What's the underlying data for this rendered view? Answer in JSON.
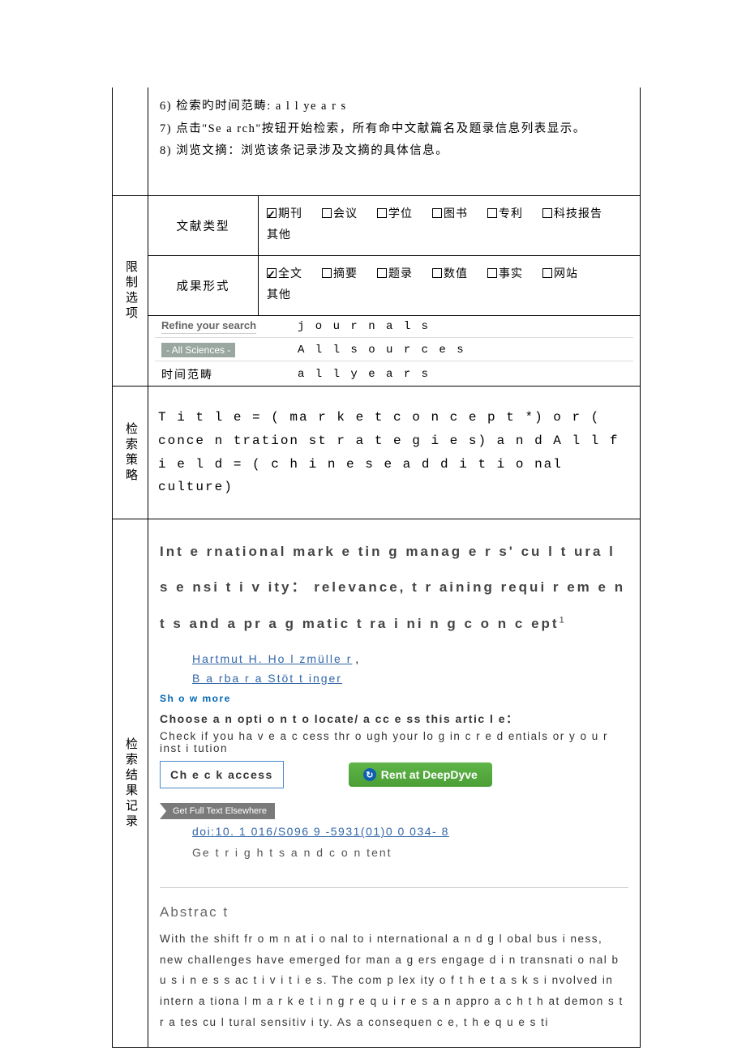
{
  "steps": {
    "s6": "6)  检索旳时间范畴: a l l ye a r s",
    "s7": "7)  点击\"Se a rch\"按钮开始检索，所有命中文献篇名及题录信息列表显示。",
    "s8": "8)  浏览文摘：浏览该条记录涉及文摘的具体信息。"
  },
  "limits": {
    "section_label": "限制选项",
    "doctype_label": "文献类型",
    "form_label": "成果形式",
    "doctypes": [
      {
        "label": "期刊",
        "checked": true
      },
      {
        "label": "会议",
        "checked": false
      },
      {
        "label": "学位",
        "checked": false
      },
      {
        "label": "图书",
        "checked": false
      },
      {
        "label": "专利",
        "checked": false
      },
      {
        "label": "科技报告",
        "checked": false
      }
    ],
    "doctype_other": "其他",
    "forms": [
      {
        "label": "全文",
        "checked": true
      },
      {
        "label": "摘要",
        "checked": false
      },
      {
        "label": "题录",
        "checked": false
      },
      {
        "label": "数值",
        "checked": false
      },
      {
        "label": "事实",
        "checked": false
      },
      {
        "label": "网站",
        "checked": false
      }
    ],
    "form_other": "其他",
    "refine_label": "Refine your search",
    "refine_val": "j o u r n a l s",
    "allsci_label": "- All Sciences -",
    "allsci_val": "A l l  s o u r c e s",
    "time_label": "时间范畴",
    "time_val": "a l l  y e a r s"
  },
  "strategy": {
    "section_label": "检索策略",
    "text": "T i t l e = ( ma r k e t  c o n c e p t *)  o r (  conce n tration st r a t e g i e s) a n d  A l l  f i e l d =  ( c h i n e s e   a d d i t i o nal culture)"
  },
  "result": {
    "section_label": "检索结果记录",
    "title": "Int e rnational mark e tin g   manag e r s' cu l t ura l  s e nsi t i v ity：   relevance,  t r aining requi r em e n t s and  a pr a g matic t ra i ni n g c o n c ept",
    "title_sup": "1",
    "author1": "Hartmut H. Ho l zmülle r",
    "author2": "B a rba r a Stöt t inger",
    "show_more": "Sh o w more",
    "choose": "Choose  a n opti o n  t o locate/ a cc e ss   this  artic l e：",
    "check_text": "Check if you ha v e  a c cess thr o ugh   your lo g in c r e d entials or    y o u r   inst i tution",
    "btn_check": "Ch e c k  access",
    "btn_deepdyve": "Rent at DeepDyve",
    "btn_getfull": "Get Full Text Elsewhere",
    "doi": "doi:10. 1 016/S096 9 -5931(01)0 0 034- 8",
    "rights": "Ge t  r i g h t s  a n d   c o n tent",
    "abstract_h": "Abstrac t",
    "abstract_txt": "With the shift fr o m  n at i o nal  to  i nternational  a n d g l obal bus i ness, new challenges   have emerged for man a g ers   engage d  i n  transnati o nal   b u s i n e s s ac t i v i t i e s. The   com p lex ity  o f t h e t a s k s  i nvolved  in intern a tiona l  m a r k e t i n g  r e q u i r e s  a n   appro a c h  t h at  demon s t r a tes cu l tural sensitiv i ty.   As a consequen c e,   t h e  q u e s ti"
  }
}
